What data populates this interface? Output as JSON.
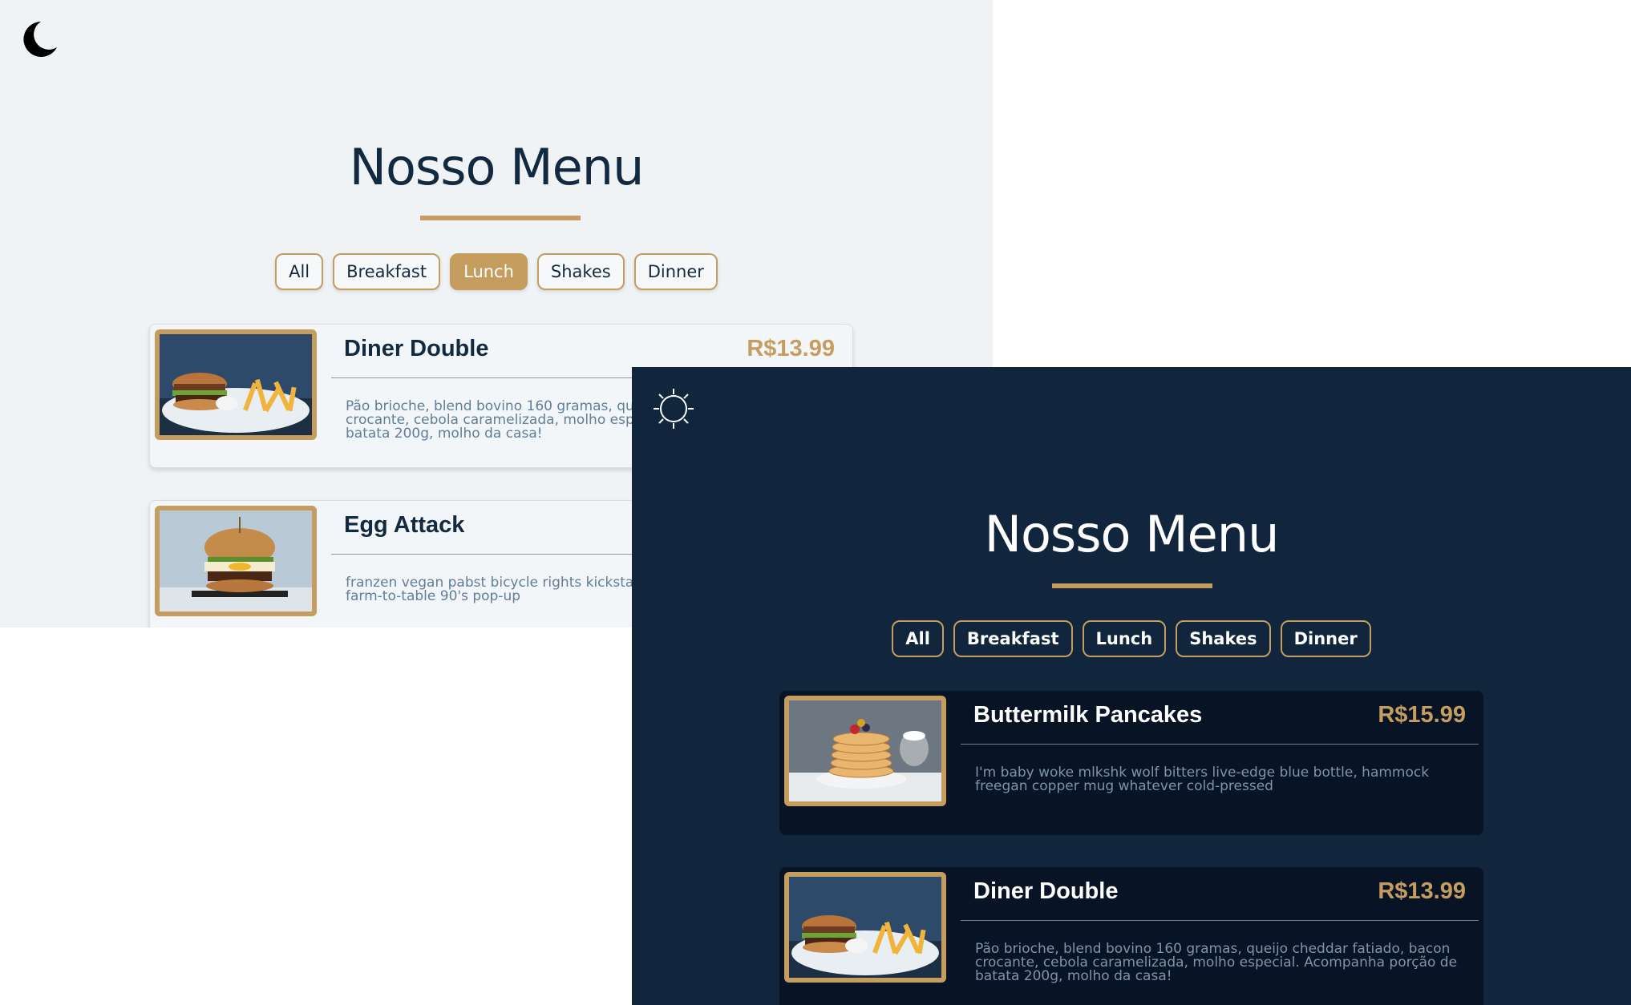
{
  "light_view": {
    "toggle_icon": "moon-icon",
    "title": "Nosso Menu",
    "filters": [
      {
        "label": "All",
        "active": false
      },
      {
        "label": "Breakfast",
        "active": false
      },
      {
        "label": "Lunch",
        "active": true
      },
      {
        "label": "Shakes",
        "active": false
      },
      {
        "label": "Dinner",
        "active": false
      }
    ],
    "items": [
      {
        "name": "Diner Double",
        "price": "R$13.99",
        "description": "Pão brioche, blend bovino 160 gramas, queijo cheddar fatiado, bacon crocante, cebola caramelizada, molho especial. Acompanha porção de batata 200g, molho da casa!",
        "image": "burger-with-fries-photo"
      },
      {
        "name": "Egg Attack",
        "price": "",
        "description": "franzen vegan pabst bicycle rights kickstarter pinterest meditation farm-to-table 90's pop-up",
        "image": "egg-burger-photo"
      }
    ]
  },
  "dark_view": {
    "toggle_icon": "sun-icon",
    "title": "Nosso Menu",
    "filters": [
      {
        "label": "All"
      },
      {
        "label": "Breakfast"
      },
      {
        "label": "Lunch"
      },
      {
        "label": "Shakes"
      },
      {
        "label": "Dinner"
      }
    ],
    "items": [
      {
        "name": "Buttermilk Pancakes",
        "price": "R$15.99",
        "description": "I'm baby woke mlkshk wolf bitters live-edge blue bottle, hammock freegan copper mug whatever cold-pressed",
        "image": "pancakes-photo"
      },
      {
        "name": "Diner Double",
        "price": "R$13.99",
        "description": "Pão brioche, blend bovino 160 gramas, queijo cheddar fatiado, bacon crocante, cebola caramelizada, molho especial. Acompanha porção de batata 200g, molho da casa!",
        "image": "burger-with-fries-photo"
      }
    ]
  },
  "colors": {
    "accent_gold": "#c59d5f",
    "light_background": "#f0f3f6",
    "dark_background": "#11263c",
    "dark_card": "#081426",
    "heading_navy": "#13293f"
  }
}
